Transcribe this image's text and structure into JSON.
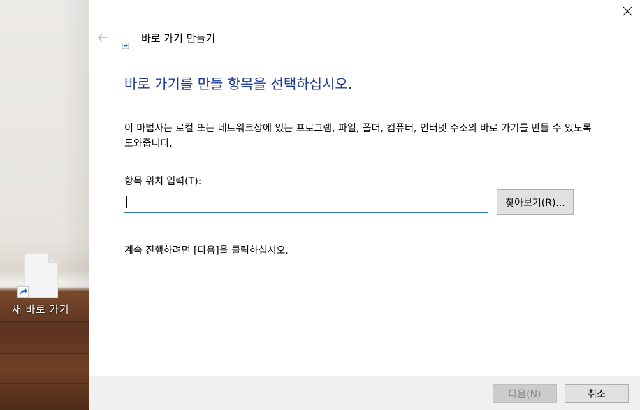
{
  "desktop": {
    "shortcut_icon_label": "새 바로 가기"
  },
  "dialog": {
    "title": "바로 가기 만들기",
    "heading": "바로 가기를 만들 항목을 선택하십시오.",
    "description": "이 마법사는 로컬 또는 네트워크상에 있는 프로그램, 파일, 폴더, 컴퓨터, 인터넷 주소의 바로 가기를 만들 수 있도록 도와줍니다.",
    "location_label": "항목 위치 입력(T):",
    "location_value": "",
    "browse_label": "찾아보기(R)...",
    "continue_text": "계속 진행하려면 [다음]을 클릭하십시오.",
    "next_label": "다음(N)",
    "cancel_label": "취소",
    "accent_color": "#1e3c96",
    "input_border_color": "#2e7fa8"
  }
}
